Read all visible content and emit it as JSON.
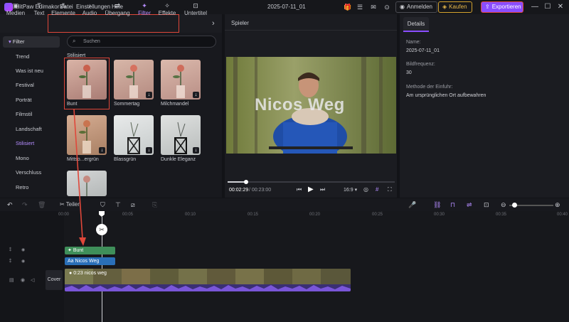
{
  "app": {
    "name": "HitPaw Edimakor",
    "project_title": "2025-07-11_01"
  },
  "menu": [
    "Datei",
    "Einstellungen",
    "Hilfe"
  ],
  "titlebar": {
    "login_label": "Anmelden",
    "buy_label": "Kaufen",
    "export_label": "Exportieren"
  },
  "toolbar": [
    {
      "label": "Medien",
      "icon": "media-icon"
    },
    {
      "label": "Text",
      "icon": "text-icon"
    },
    {
      "label": "Elemente",
      "icon": "elements-icon"
    },
    {
      "label": "Audio",
      "icon": "audio-icon"
    },
    {
      "label": "Übergang",
      "icon": "transition-icon"
    },
    {
      "label": "Filter",
      "icon": "filter-icon",
      "active": true
    },
    {
      "label": "Effekte",
      "icon": "effects-icon"
    },
    {
      "label": "Untertitel",
      "icon": "subtitle-icon"
    }
  ],
  "sidebar": {
    "header": "Filter",
    "items": [
      "Trend",
      "Was ist neu",
      "Festival",
      "Porträt",
      "Filmstil",
      "Landschaft",
      "Stilisiert",
      "Mono",
      "Verschluss",
      "Retro"
    ],
    "active": "Stilisiert"
  },
  "search": {
    "placeholder": "Suchen"
  },
  "section_title": "Stilisiert",
  "filters": [
    {
      "label": "Bunt",
      "selected": true
    },
    {
      "label": "Sommertag"
    },
    {
      "label": "Milchmandel"
    },
    {
      "label": "Mittso...ergrün"
    },
    {
      "label": "Blassgrün"
    },
    {
      "label": "Dunkle Eleganz"
    },
    {
      "label": ""
    }
  ],
  "player": {
    "title": "Spieler",
    "overlay_text": "Nicos Weg",
    "current_time": "00:02:29",
    "total_time": "00:23:00",
    "aspect": "16:9",
    "progress": 0.11
  },
  "details": {
    "tab": "Details",
    "fields": [
      {
        "label": "Name:",
        "value": "2025-07-11_01"
      },
      {
        "label": "Bildfrequenz:",
        "value": "30"
      },
      {
        "label": "Methode der Einfuhr:",
        "value": "Am ursprünglichen Ort aufbewahren"
      }
    ]
  },
  "timeline": {
    "split_label": "Teilen",
    "ruler": [
      "00:00",
      "00:05",
      "00:10",
      "00:15",
      "00:20",
      "00:25",
      "00:30",
      "00:35",
      "00:40"
    ],
    "filter_clip": "Bunt",
    "text_clip": "Nicos Weg",
    "cover_label": "Cover",
    "video_clip": "0:23 nicos weg"
  },
  "colors": {
    "accent": "#8a4dff",
    "highlight": "#e0473a",
    "filter_clip": "#3f8f5a",
    "text_clip": "#2a6fb8",
    "audio_wave": "#7a56d8"
  }
}
